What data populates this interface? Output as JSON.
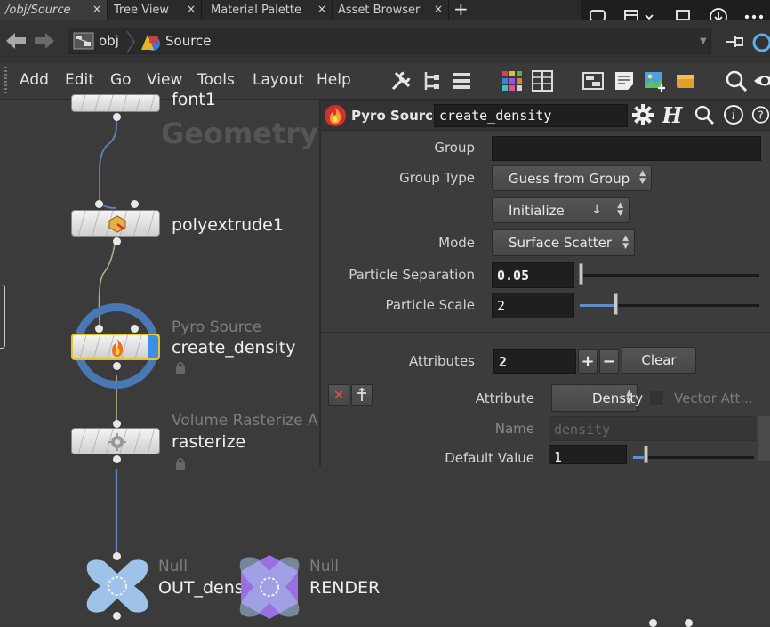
{
  "tabs": [
    {
      "label": "/obj/Source",
      "close": "×",
      "active": true
    },
    {
      "label": "Tree View",
      "close": "×"
    },
    {
      "label": "Material Palette",
      "close": "×"
    },
    {
      "label": "Asset Browser",
      "close": "×"
    }
  ],
  "tab_add": "+",
  "path": {
    "root": "obj",
    "current": "Source"
  },
  "menu": [
    "Add",
    "Edit",
    "Go",
    "View",
    "Tools",
    "Layout",
    "Help"
  ],
  "network": {
    "watermark": "Geometry",
    "nodes": [
      {
        "name": "font1"
      },
      {
        "name": "polyextrude1"
      },
      {
        "type": "Pyro Source",
        "name": "create_density"
      },
      {
        "type": "Volume Rasterize A",
        "name": "rasterize"
      },
      {
        "type": "Null",
        "name": "OUT_density"
      },
      {
        "type": "Null",
        "name": "RENDER"
      }
    ]
  },
  "params": {
    "node_type": "Pyro Source",
    "node_name": "create_density",
    "group_label": "Group",
    "group_value": "",
    "group_type_label": "Group Type",
    "group_type_value": "Guess from Group",
    "initialize_value": "Initialize",
    "initialize_arrow": "↓",
    "mode_label": "Mode",
    "mode_value": "Surface Scatter",
    "particle_separation_label": "Particle Separation",
    "particle_separation_value": "0.05",
    "particle_separation_slider": 0.0,
    "particle_scale_label": "Particle Scale",
    "particle_scale_value": "2",
    "particle_scale_slider": 0.2,
    "attributes_label": "Attributes",
    "attributes_value": "2",
    "plus": "+",
    "minus": "−",
    "clear_label": "Clear",
    "attribute_label": "Attribute",
    "attribute_value": "Density",
    "vector_attr_label": "Vector Att...",
    "name_label": "Name",
    "name_value": "density",
    "default_value_label": "Default Value",
    "default_value": "1",
    "default_value_slider": 0.1
  },
  "colors": {
    "accent_blue": "#4a78b5",
    "selected_node_border": "#e6c230",
    "render_purple": "#9a6fe0",
    "null_blue": "#9fc3e8"
  }
}
